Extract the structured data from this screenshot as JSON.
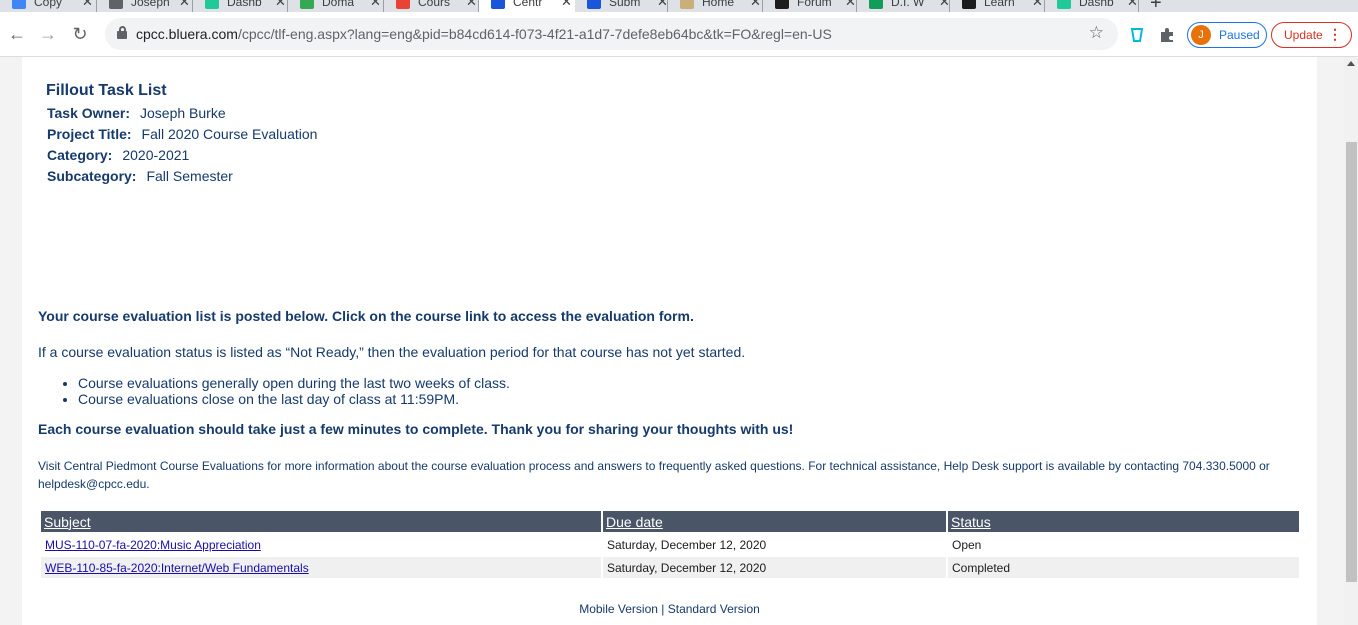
{
  "browser": {
    "tabs": [
      {
        "label": "Copy",
        "color": "#4285f4",
        "active": false
      },
      {
        "label": "Joseph",
        "color": "#5f6368",
        "active": false
      },
      {
        "label": "Dashb",
        "color": "#20c997",
        "active": false
      },
      {
        "label": "Doma",
        "color": "#34a853",
        "active": false
      },
      {
        "label": "Cours",
        "color": "#ea4335",
        "active": false
      },
      {
        "label": "Centr",
        "color": "#1a56db",
        "active": true
      },
      {
        "label": "Subm",
        "color": "#1a56db",
        "active": false
      },
      {
        "label": "Home",
        "color": "#c9b07a",
        "active": false
      },
      {
        "label": "Forum",
        "color": "#1c1c1c",
        "active": false
      },
      {
        "label": "D.I. W",
        "color": "#0f9d58",
        "active": false
      },
      {
        "label": "Learn",
        "color": "#1c1c1c",
        "active": false
      },
      {
        "label": "Dashb",
        "color": "#20c997",
        "active": false
      }
    ],
    "url_host": "cpcc.bluera.com",
    "url_path": "/cpcc/tlf-eng.aspx?lang=eng&pid=b84cd614-f073-4f21-a1d7-7defe8eb64bc&tk=FO&regl=en-US",
    "profile_initial": "J",
    "profile_status": "Paused",
    "update_label": "Update"
  },
  "task": {
    "title": "Fillout Task List",
    "owner_label": "Task Owner:",
    "owner": "Joseph Burke",
    "project_label": "Project Title:",
    "project": "Fall 2020 Course Evaluation",
    "category_label": "Category:",
    "category": "2020-2021",
    "subcategory_label": "Subcategory:",
    "subcategory": "Fall Semester"
  },
  "intro": {
    "headline": "Your course evaluation list is posted below. Click on the course link to access the evaluation form.",
    "not_ready": "If a course evaluation status is listed as “Not Ready,” then the evaluation period for that course has not yet started.",
    "bullets": [
      "Course evaluations generally open during the last two weeks of class.",
      "Course evaluations close on the last day of class at 11:59PM."
    ],
    "thanks": "Each course evaluation should take just a few minutes to complete. Thank you for sharing your thoughts with us!",
    "visit": "Visit Central Piedmont Course Evaluations for more information about the course evaluation process and answers to frequently asked questions. For technical assistance, Help Desk support is available by contacting 704.330.5000 or helpdesk@cpcc.edu."
  },
  "table": {
    "headers": [
      "Subject",
      "Due date",
      "Status"
    ],
    "rows": [
      {
        "subject": "MUS-110-07-fa-2020:Music Appreciation",
        "due": "Saturday, December 12, 2020",
        "status": "Open"
      },
      {
        "subject": "WEB-110-85-fa-2020:Internet/Web Fundamentals",
        "due": "Saturday, December 12, 2020",
        "status": "Completed"
      }
    ]
  },
  "footer": {
    "mobile": "Mobile Version",
    "separator": "|",
    "standard": "Standard Version"
  }
}
